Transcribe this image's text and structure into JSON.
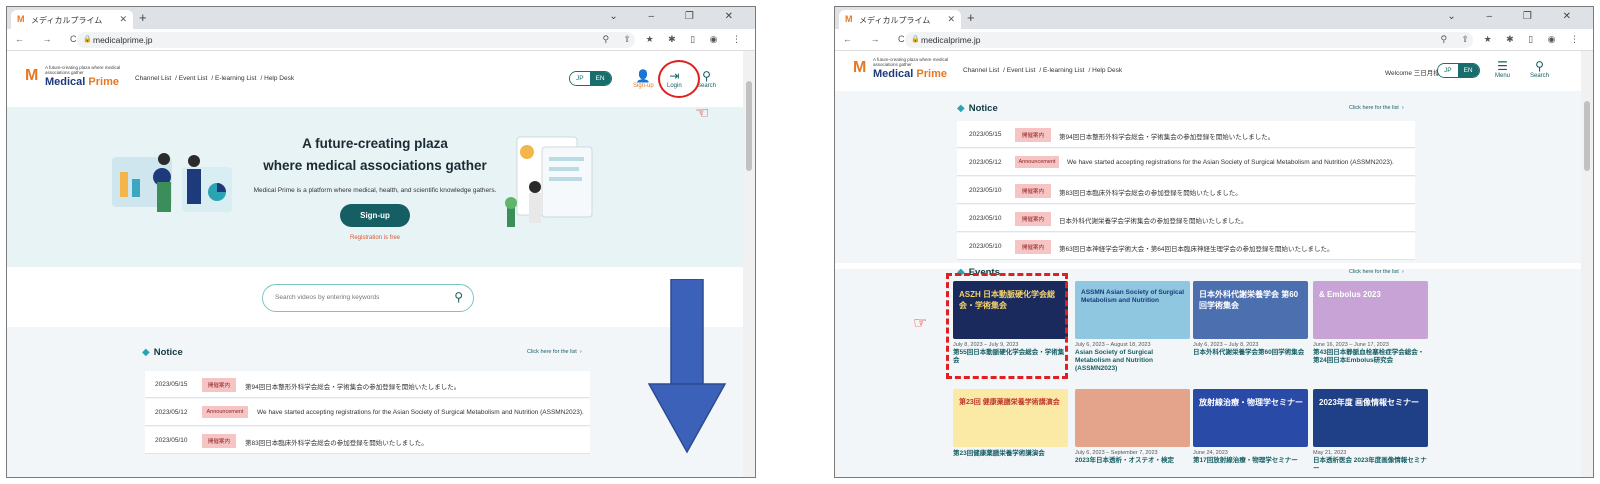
{
  "browser": {
    "tab_title": "メディカルプライム",
    "new_tab": "+",
    "window_controls": "⌄ – ❐ ✕",
    "nav_glyphs": "← → C ⌂",
    "url": "medicalprime.jp",
    "ext_glyphs": "⚲ ⇪ ★ ✱ ▯ ◉ ⋮"
  },
  "site": {
    "tagline": "A future-creating plaza where medical associations gather",
    "brand_medical": "Medical",
    "brand_prime": "Prime",
    "nav": [
      "Channel List",
      "Event List",
      "E-learning List",
      "Help Desk"
    ],
    "lang_jp": "JP",
    "lang_en": "EN",
    "signup_label": "Sign-up",
    "login_label": "Login",
    "search_label": "Search",
    "welcome": "Welcome 三日月様",
    "menu_label": "Menu"
  },
  "hero": {
    "line1": "A future-creating plaza",
    "line2": "where medical associations gather",
    "description": "Medical Prime is a platform where medical, health, and scientific knowledge gathers.",
    "signup_button": "Sign-up",
    "registration_free": "Registration is free"
  },
  "search": {
    "placeholder": "Search videos by entering keywords"
  },
  "notice": {
    "title": "Notice",
    "click_list": "Click here for the list",
    "rows": [
      {
        "date": "2023/05/15",
        "tag": "開催案内",
        "text": "第94回日本整形外科学会総会・学術集会の参加登録を開始いたしました。"
      },
      {
        "date": "2023/05/12",
        "tag": "Announcement",
        "text": "We have started accepting registrations for the Asian Society of Surgical Metabolism and Nutrition (ASSMN2023)."
      },
      {
        "date": "2023/05/10",
        "tag": "開催案内",
        "text": "第83回日本臨床外科学会総会の参加登録を開始いたしました。"
      },
      {
        "date": "2023/05/10",
        "tag": "開催案内",
        "text": "日本外科代謝栄養学会学術集会の参加登録を開始いたしました。"
      },
      {
        "date": "2023/05/10",
        "tag": "開催案内",
        "text": "第63回日本神経学会学術大会・第64回日本臨床神経生理学会の参加登録を開始いたしました。"
      }
    ]
  },
  "events": {
    "title": "Events",
    "click_list": "Click here for the list",
    "cards": [
      {
        "label": "ASZH 日本動脈硬化学会総会・学術集会",
        "date": "July 8, 2023 – July 9, 2023",
        "title": "第55回日本動脈硬化学会総会・学術集会"
      },
      {
        "label": "ASSMN Asian Society of Surgical Metabolism and Nutrition",
        "date": "July 6, 2023 – August 18, 2023",
        "title": "Asian Society of Surgical Metabolism and Nutrition (ASSMN2023)"
      },
      {
        "label": "日本外科代謝栄養学会 第60回学術集会",
        "date": "July 6, 2023 – July 8, 2023",
        "title": "日本外科代謝栄養学会第60回学術集会"
      },
      {
        "label": "& Embolus 2023",
        "date": "June 16, 2023 – June 17, 2023",
        "title": "第43回日本静脈血栓塞栓症学会総会・第24回日本Embolus研究会"
      },
      {
        "label": "第23回 健康薬膳栄養学術講演会",
        "date": "",
        "title": "第23回健康薬膳栄養学術講演会"
      },
      {
        "label": "",
        "date": "July 6, 2023 – September 7, 2023",
        "title": "2023年日本透析・オステオ・検定"
      },
      {
        "label": "放射線治療・物理学セミナー",
        "date": "June 24, 2023",
        "title": "第17回放射線治療・物理学セミナー"
      },
      {
        "label": "2023年度 画像情報セミナー",
        "date": "May 21, 2023",
        "title": "日本透析医会 2023年度画像情報セミナー"
      }
    ]
  },
  "colors": {
    "accent": "#155e63",
    "brand_orange": "#e87722",
    "annotation_red": "#e02020",
    "arrow_blue": "#3b62b8",
    "tag_pink": "#f7c4c4"
  }
}
